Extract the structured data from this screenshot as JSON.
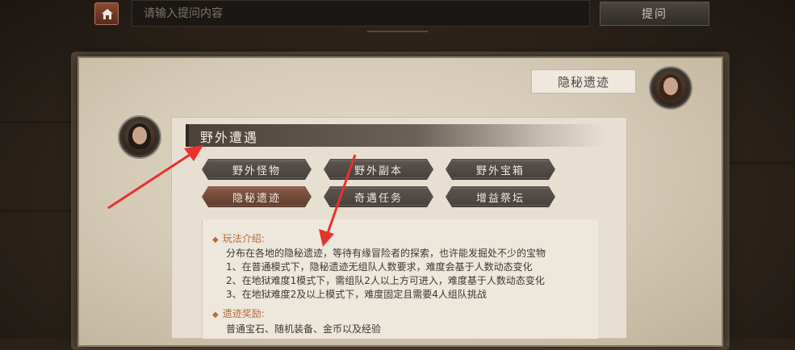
{
  "topbar": {
    "search_placeholder": "请输入提问内容",
    "ask_label": "提问"
  },
  "npc": {
    "bubble_text": "隐秘遗迹"
  },
  "reply": {
    "title": "野外遭遇",
    "options": [
      {
        "label": "野外怪物",
        "active": false
      },
      {
        "label": "野外副本",
        "active": false
      },
      {
        "label": "野外宝箱",
        "active": false
      },
      {
        "label": "隐秘遗迹",
        "active": true
      },
      {
        "label": "奇遇任务",
        "active": false
      },
      {
        "label": "增益祭坛",
        "active": false
      }
    ],
    "intro_heading": "玩法介绍:",
    "intro_lines": [
      "分布在各地的隐秘遗迹，等待有缘冒险者的探索，也许能发掘处不少的宝物",
      "1、在普通模式下，隐秘遗迹无组队人数要求，难度会基于人数动态变化",
      "2、在地狱难度1模式下，需组队2人以上方可进入，难度基于人数动态变化",
      "3、在地狱难度2及以上模式下，难度固定且需要4人组队挑战"
    ],
    "reward_heading": "遗迹奖励:",
    "reward_line": "普通宝石、随机装备、金币以及经验"
  },
  "colors": {
    "accent_heading": "#b36a3e",
    "annotation_arrow": "#e8322e",
    "active_button": "#8a5c46"
  }
}
